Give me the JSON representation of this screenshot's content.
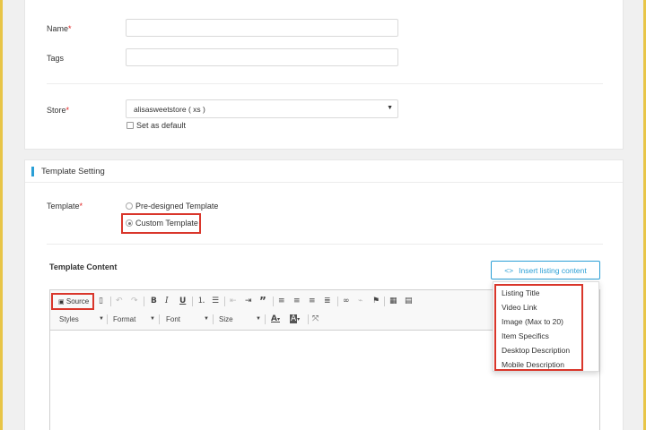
{
  "basic_info": {
    "name_label": "Name",
    "required_mark": "*",
    "name_value": "",
    "tags_label": "Tags",
    "tags_value": "",
    "store_label": "Store",
    "store_value": "alisasweetstore ( xs )",
    "set_default_label": "Set as default",
    "set_default_checked": false
  },
  "template_setting": {
    "section_title": "Template Setting",
    "template_label": "Template",
    "options": [
      {
        "label": "Pre-designed Template",
        "selected": false
      },
      {
        "label": "Custom Template",
        "selected": true
      }
    ],
    "content_label": "Template Content",
    "insert_button_label": "Insert listing content",
    "insert_button_icon": "code-icon",
    "highlight_color": "#d9362b",
    "accent_color": "#2a9fd6"
  },
  "editor": {
    "source_label": "Source",
    "combos": {
      "styles": "Styles",
      "format": "Format",
      "font": "Font",
      "size": "Size"
    },
    "content": ""
  },
  "insert_menu": {
    "items": [
      "Listing Title",
      "Video Link",
      "Image (Max to 20)",
      "Item Specifics",
      "Desktop Description",
      "Mobile Description"
    ]
  }
}
